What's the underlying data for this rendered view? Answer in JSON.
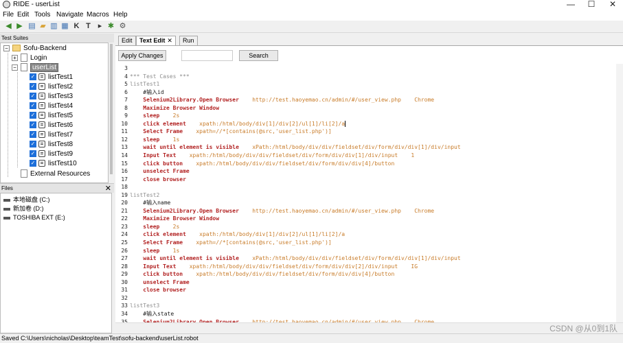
{
  "window": {
    "title": "RIDE - userList",
    "minimize": "—",
    "maximize": "☐",
    "close": "✕"
  },
  "menu": [
    "File",
    "Edit",
    "Tools",
    "Navigate",
    "Macros",
    "Help"
  ],
  "toolbar_icons": [
    "back-arrow-icon",
    "forward-arrow-icon",
    "save-icon",
    "open-folder-icon",
    "save-all-icon",
    "open-dir-icon",
    "search-keyword-icon",
    "test-case-icon",
    "run-icon",
    "stop-icon",
    "settings-icon"
  ],
  "suites": {
    "header": "Test Suites",
    "root": "Sofu-Backend",
    "login": "Login",
    "user_list": "userList",
    "tests": [
      "listTest1",
      "listTest2",
      "listTest3",
      "listTest4",
      "listTest5",
      "listTest6",
      "listTest7",
      "listTest8",
      "listTest9",
      "listTest10"
    ],
    "external": "External Resources"
  },
  "files": {
    "header": "Files",
    "close": "✕",
    "drives": [
      "本地磁盘 (C:)",
      "新加卷 (D:)",
      "TOSHIBA EXT (E:)"
    ]
  },
  "tabs": {
    "edit": "Edit",
    "text_edit": "Text Edit",
    "run": "Run",
    "close": "✕"
  },
  "editor_toolbar": {
    "apply": "Apply Changes",
    "search_value": "",
    "search_button": "Search"
  },
  "editor": {
    "lines": [
      {
        "n": "3",
        "parts": []
      },
      {
        "n": "4",
        "parts": [
          {
            "t": "*** Test Cases ***",
            "c": "sec"
          }
        ]
      },
      {
        "n": "5",
        "parts": [
          {
            "t": "listTest1",
            "c": "tcname"
          }
        ]
      },
      {
        "n": "6",
        "parts": [
          {
            "t": "    #输入id",
            "c": "plain"
          }
        ]
      },
      {
        "n": "7",
        "parts": [
          {
            "t": "    Selenium2Library.Open Browser",
            "c": "kw"
          },
          {
            "t": "    http://test.haoyemao.cn/admin/#/user_view.php    Chrome",
            "c": "arg"
          }
        ]
      },
      {
        "n": "8",
        "parts": [
          {
            "t": "    Maximize Browser Window",
            "c": "kw"
          }
        ]
      },
      {
        "n": "9",
        "parts": [
          {
            "t": "    sleep",
            "c": "kw"
          },
          {
            "t": "    2s",
            "c": "arg"
          }
        ]
      },
      {
        "n": "10",
        "parts": [
          {
            "t": "    click element",
            "c": "kw"
          },
          {
            "t": "    xpath:/html/body/div[1]/div[2]/ul[1]/li[2]/a",
            "c": "arg"
          }
        ],
        "cursor": true
      },
      {
        "n": "11",
        "parts": [
          {
            "t": "    Select Frame",
            "c": "kw"
          },
          {
            "t": "    xpath=//*[contains(@src,'user_list.php')]",
            "c": "arg"
          }
        ]
      },
      {
        "n": "12",
        "parts": [
          {
            "t": "    sleep",
            "c": "kw"
          },
          {
            "t": "    1s",
            "c": "arg"
          }
        ]
      },
      {
        "n": "13",
        "parts": [
          {
            "t": "    wait until element is visible",
            "c": "kw"
          },
          {
            "t": "    xPath:/html/body/div/div/fieldset/div/form/div/div[1]/div/input",
            "c": "arg"
          }
        ]
      },
      {
        "n": "14",
        "parts": [
          {
            "t": "    Input Text",
            "c": "kw"
          },
          {
            "t": "    xpath:/html/body/div/div/fieldset/div/form/div/div[1]/div/input    1",
            "c": "arg"
          }
        ]
      },
      {
        "n": "15",
        "parts": [
          {
            "t": "    click button",
            "c": "kw"
          },
          {
            "t": "    xpath:/html/body/div/div/fieldset/div/form/div/div[4]/button",
            "c": "arg"
          }
        ]
      },
      {
        "n": "16",
        "parts": [
          {
            "t": "    unselect Frame",
            "c": "kw"
          }
        ]
      },
      {
        "n": "17",
        "parts": [
          {
            "t": "    close browser",
            "c": "kw"
          }
        ]
      },
      {
        "n": "18",
        "parts": []
      },
      {
        "n": "19",
        "parts": [
          {
            "t": "listTest2",
            "c": "tcname"
          }
        ]
      },
      {
        "n": "20",
        "parts": [
          {
            "t": "    #输入name",
            "c": "plain"
          }
        ]
      },
      {
        "n": "21",
        "parts": [
          {
            "t": "    Selenium2Library.Open Browser",
            "c": "kw"
          },
          {
            "t": "    http://test.haoyemao.cn/admin/#/user_view.php    Chrome",
            "c": "arg"
          }
        ]
      },
      {
        "n": "22",
        "parts": [
          {
            "t": "    Maximize Browser Window",
            "c": "kw"
          }
        ]
      },
      {
        "n": "23",
        "parts": [
          {
            "t": "    sleep",
            "c": "kw"
          },
          {
            "t": "    2s",
            "c": "arg"
          }
        ]
      },
      {
        "n": "24",
        "parts": [
          {
            "t": "    click element",
            "c": "kw"
          },
          {
            "t": "    xpath:/html/body/div[1]/div[2]/ul[1]/li[2]/a",
            "c": "arg"
          }
        ]
      },
      {
        "n": "25",
        "parts": [
          {
            "t": "    Select Frame",
            "c": "kw"
          },
          {
            "t": "    xpath=//*[contains(@src,'user_list.php')]",
            "c": "arg"
          }
        ]
      },
      {
        "n": "26",
        "parts": [
          {
            "t": "    sleep",
            "c": "kw"
          },
          {
            "t": "    1s",
            "c": "arg"
          }
        ]
      },
      {
        "n": "27",
        "parts": [
          {
            "t": "    wait until element is visible",
            "c": "kw"
          },
          {
            "t": "    xPath:/html/body/div/div/fieldset/div/form/div/div[1]/div/input",
            "c": "arg"
          }
        ]
      },
      {
        "n": "28",
        "parts": [
          {
            "t": "    Input Text",
            "c": "kw"
          },
          {
            "t": "    xpath:/html/body/div/div/fieldset/div/form/div/div[2]/div/input    IG",
            "c": "arg"
          }
        ]
      },
      {
        "n": "29",
        "parts": [
          {
            "t": "    click button",
            "c": "kw"
          },
          {
            "t": "    xpath:/html/body/div/div/fieldset/div/form/div/div[4]/button",
            "c": "arg"
          }
        ]
      },
      {
        "n": "30",
        "parts": [
          {
            "t": "    unselect Frame",
            "c": "kw"
          }
        ]
      },
      {
        "n": "31",
        "parts": [
          {
            "t": "    close browser",
            "c": "kw"
          }
        ]
      },
      {
        "n": "32",
        "parts": []
      },
      {
        "n": "33",
        "parts": [
          {
            "t": "listTest3",
            "c": "tcname"
          }
        ]
      },
      {
        "n": "34",
        "parts": [
          {
            "t": "    #输入state",
            "c": "plain"
          }
        ]
      },
      {
        "n": "35",
        "parts": [
          {
            "t": "    Selenium2Library.Open Browser",
            "c": "kw"
          },
          {
            "t": "    http://test.haoyemao.cn/admin/#/user_view.php    Chrome",
            "c": "arg"
          }
        ]
      }
    ]
  },
  "status": "Saved C:\\Users\\nicholas\\Desktop\\teamTest\\sofu-backend\\userList.robot",
  "watermark": "CSDN @从0到1队"
}
